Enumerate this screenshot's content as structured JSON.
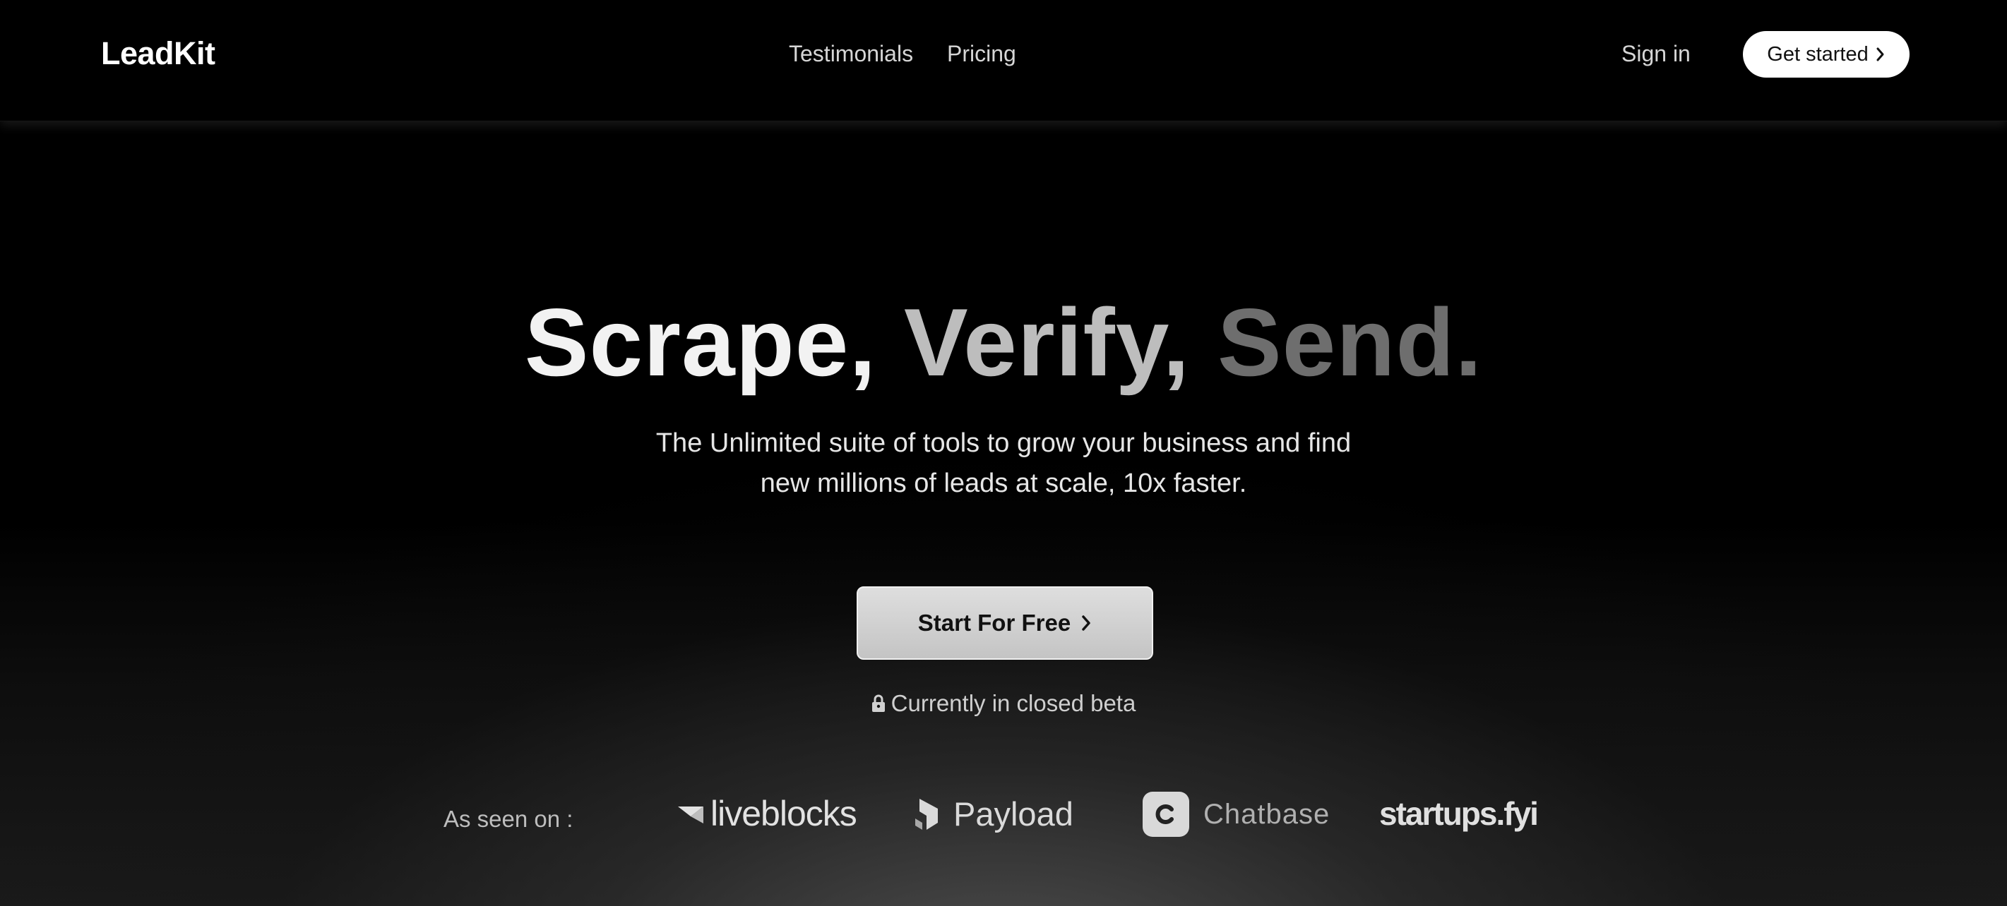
{
  "header": {
    "logo": "LeadKit",
    "nav": [
      {
        "label": "Testimonials"
      },
      {
        "label": "Pricing"
      }
    ],
    "sign_in": "Sign in",
    "get_started": "Get started"
  },
  "hero": {
    "headline": {
      "word1": "Scrape,",
      "word2": "Verify,",
      "word3": "Send."
    },
    "subtitle_line1": "The Unlimited suite of tools to grow your business and find",
    "subtitle_line2": "new millions of leads at scale, 10x faster.",
    "cta": "Start For Free",
    "beta_note": "Currently in closed beta"
  },
  "seen_on": {
    "label": "As seen on :",
    "brands": [
      {
        "name": "liveblocks",
        "icon": "liveblocks-logo-icon"
      },
      {
        "name": "Payload",
        "icon": "payload-logo-icon"
      },
      {
        "name": "Chatbase",
        "icon": "chatbase-logo-icon"
      },
      {
        "name": "startups.fyi",
        "icon": ""
      }
    ]
  },
  "colors": {
    "background": "#000000",
    "text_primary": "#ffffff",
    "cta_bg": "#d0d0d0"
  },
  "icons": {
    "chevron": "chevron-right-icon",
    "lock": "lock-icon"
  }
}
